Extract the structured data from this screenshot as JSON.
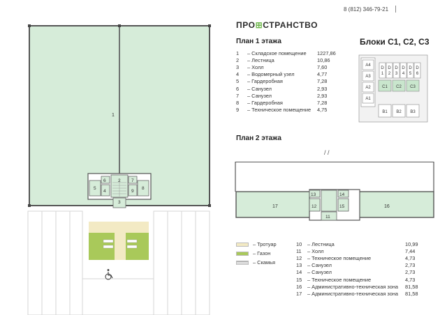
{
  "header": {
    "phone": "8 (812) 346-79-21",
    "brand_part1": "ПРО",
    "brand_part2": "СТРАНСТВО",
    "blocks_title": "Блоки С1, С2, С3"
  },
  "colors": {
    "green_fill": "#d6ecd9",
    "green_stroke": "#7aa488",
    "sidewalk": "#f3eac4",
    "lawn": "#a9c95a",
    "highlight": "#c9e6cd"
  },
  "floor1": {
    "title": "План 1 этажа",
    "rooms": [
      {
        "num": "1",
        "name": "Складское помещение",
        "area": "1227,86"
      },
      {
        "num": "2",
        "name": "Лестница",
        "area": "10,86"
      },
      {
        "num": "3",
        "name": "Холл",
        "area": "7,60"
      },
      {
        "num": "4",
        "name": "Водомерный узел",
        "area": "4,77"
      },
      {
        "num": "5",
        "name": "Гардеробная",
        "area": "7,28"
      },
      {
        "num": "6",
        "name": "Санузел",
        "area": "2,93"
      },
      {
        "num": "7",
        "name": "Санузел",
        "area": "2,93"
      },
      {
        "num": "8",
        "name": "Гардеробная",
        "area": "7,28"
      },
      {
        "num": "9",
        "name": "Техническое помещение",
        "area": "4,75"
      }
    ],
    "labels": {
      "r1": "1",
      "r2": "2",
      "r3": "3",
      "r4": "4",
      "r5": "5",
      "r6": "6",
      "r7": "7",
      "r8": "8",
      "r9": "9"
    }
  },
  "floor2": {
    "title": "План 2 этажа",
    "rooms": [
      {
        "num": "10",
        "name": "Лестница",
        "area": "10,99"
      },
      {
        "num": "11",
        "name": "Холл",
        "area": "7,44"
      },
      {
        "num": "12",
        "name": "Техническое помещение",
        "area": "4,73"
      },
      {
        "num": "13",
        "name": "Санузел",
        "area": "2,73"
      },
      {
        "num": "14",
        "name": "Санузел",
        "area": "2,73"
      },
      {
        "num": "15",
        "name": "Техническое помещение",
        "area": "4,73"
      },
      {
        "num": "16",
        "name": "Административно-техническая зона",
        "area": "81,58"
      },
      {
        "num": "17",
        "name": "Административно-техническая зона",
        "area": "81,58"
      }
    ],
    "labels": {
      "r11": "11",
      "r12": "12",
      "r13": "13",
      "r14": "14",
      "r15": "15",
      "r16": "16",
      "r17": "17"
    }
  },
  "legend": [
    {
      "label": "Тротуар",
      "color": "#f3eac4"
    },
    {
      "label": "Газон",
      "color": "#a9c95a"
    },
    {
      "label": "Скамья",
      "color": "#ffffff"
    }
  ],
  "blocks_map": {
    "a_labels": [
      "A4",
      "A3",
      "A2",
      "A1"
    ],
    "d_labels": [
      [
        "D",
        "1"
      ],
      [
        "D",
        "2"
      ],
      [
        "D",
        "3"
      ],
      [
        "D",
        "4"
      ],
      [
        "D",
        "5"
      ],
      [
        "D",
        "6"
      ]
    ],
    "c_labels": [
      "C1",
      "C2",
      "C3"
    ],
    "b_labels": [
      "B1",
      "B2",
      "B3"
    ]
  }
}
